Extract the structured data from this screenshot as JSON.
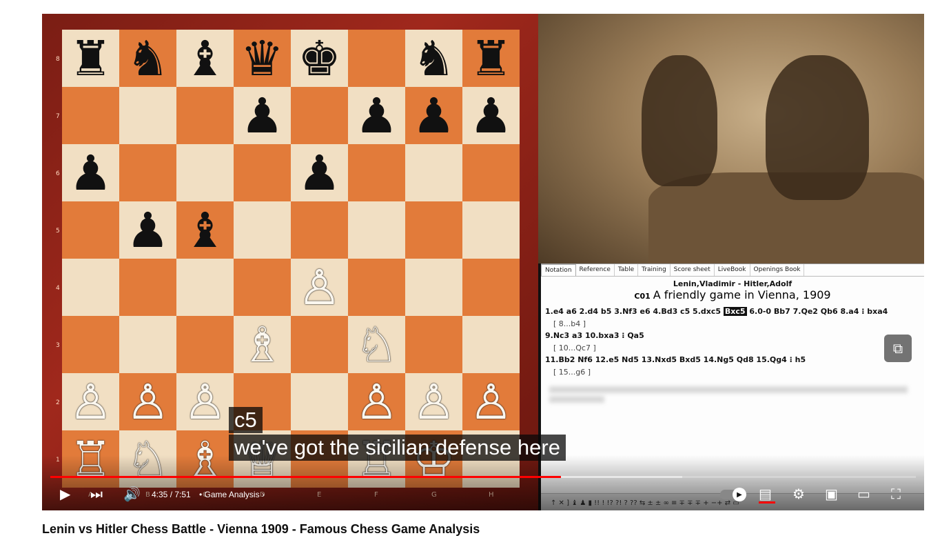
{
  "board": {
    "ranks": [
      "8",
      "7",
      "6",
      "5",
      "4",
      "3",
      "2",
      "1"
    ],
    "files": [
      "A",
      "B",
      "C",
      "D",
      "E",
      "F",
      "G",
      "H"
    ],
    "rows": [
      [
        {
          "p": "♜",
          "c": "b"
        },
        {
          "p": "♞",
          "c": "b"
        },
        {
          "p": "♝",
          "c": "b"
        },
        {
          "p": "♛",
          "c": "b"
        },
        {
          "p": "♚",
          "c": "b"
        },
        {
          "p": "",
          "c": ""
        },
        {
          "p": "♞",
          "c": "b"
        },
        {
          "p": "♜",
          "c": "b"
        }
      ],
      [
        {
          "p": "",
          "c": ""
        },
        {
          "p": "",
          "c": ""
        },
        {
          "p": "",
          "c": ""
        },
        {
          "p": "♟",
          "c": "b"
        },
        {
          "p": "",
          "c": ""
        },
        {
          "p": "♟",
          "c": "b"
        },
        {
          "p": "♟",
          "c": "b"
        },
        {
          "p": "♟",
          "c": "b"
        }
      ],
      [
        {
          "p": "♟",
          "c": "b"
        },
        {
          "p": "",
          "c": ""
        },
        {
          "p": "",
          "c": ""
        },
        {
          "p": "",
          "c": ""
        },
        {
          "p": "♟",
          "c": "b"
        },
        {
          "p": "",
          "c": ""
        },
        {
          "p": "",
          "c": ""
        },
        {
          "p": "",
          "c": ""
        }
      ],
      [
        {
          "p": "",
          "c": ""
        },
        {
          "p": "♟",
          "c": "b"
        },
        {
          "p": "♝",
          "c": "b"
        },
        {
          "p": "",
          "c": ""
        },
        {
          "p": "",
          "c": ""
        },
        {
          "p": "",
          "c": ""
        },
        {
          "p": "",
          "c": ""
        },
        {
          "p": "",
          "c": ""
        }
      ],
      [
        {
          "p": "",
          "c": ""
        },
        {
          "p": "",
          "c": ""
        },
        {
          "p": "",
          "c": ""
        },
        {
          "p": "",
          "c": ""
        },
        {
          "p": "♙",
          "c": "w"
        },
        {
          "p": "",
          "c": ""
        },
        {
          "p": "",
          "c": ""
        },
        {
          "p": "",
          "c": ""
        }
      ],
      [
        {
          "p": "",
          "c": ""
        },
        {
          "p": "",
          "c": ""
        },
        {
          "p": "",
          "c": ""
        },
        {
          "p": "♗",
          "c": "w"
        },
        {
          "p": "",
          "c": ""
        },
        {
          "p": "♘",
          "c": "w"
        },
        {
          "p": "",
          "c": ""
        },
        {
          "p": "",
          "c": ""
        }
      ],
      [
        {
          "p": "♙",
          "c": "w"
        },
        {
          "p": "♙",
          "c": "w"
        },
        {
          "p": "♙",
          "c": "w"
        },
        {
          "p": "",
          "c": ""
        },
        {
          "p": "",
          "c": ""
        },
        {
          "p": "♙",
          "c": "w"
        },
        {
          "p": "♙",
          "c": "w"
        },
        {
          "p": "♙",
          "c": "w"
        }
      ],
      [
        {
          "p": "♖",
          "c": "w"
        },
        {
          "p": "♘",
          "c": "w"
        },
        {
          "p": "♗",
          "c": "w"
        },
        {
          "p": "♕",
          "c": "w"
        },
        {
          "p": "",
          "c": ""
        },
        {
          "p": "♖",
          "c": "w"
        },
        {
          "p": "♔",
          "c": "w"
        },
        {
          "p": "",
          "c": ""
        }
      ]
    ]
  },
  "notation": {
    "tabs": [
      "Notation",
      "Reference",
      "Table",
      "Training",
      "Score sheet",
      "LiveBook",
      "Openings Book"
    ],
    "players": "Lenin,Vladimir - Hitler,Adolf",
    "eco": "C01",
    "event": "A friendly game in Vienna, 1909",
    "line1_a": "1.e4  a6  2.d4  b5  3.Nf3  e6  4.Bd3  c5  5.dxc5 ",
    "line1_hl": "Bxc5",
    "line1_b": " 6.0-0  Bb7  7.Qe2  Qb6  8.a4  ⁝  bxa4",
    "var1": "[ 8...b4 ]",
    "line2": "9.Nc3  a3  10.bxa3  ⁝  Qa5",
    "var2": "[ 10...Qc7 ]",
    "line3": "11.Bb2  Nf6  12.e5  Nd5  13.Nxd5  Bxd5  14.Ng5  Qd8  15.Qg4  ⁝  h5",
    "var3": "[ 15...g6 ]",
    "toolbar": "↑  ✕  ]  ♝  ♟  ▮  !!   !   !?  ?!   ?   ??   ⇆   ±   ±   ∞   ≡   ∓   ∓   ∓   +  −+  ⇄  ▭"
  },
  "captions": {
    "line1": "c5",
    "line2": "we've got the sicilian defense here"
  },
  "controls": {
    "time": "4:35 / 7:51",
    "chapter": "• Game Analysis  ›",
    "played_fraction": 0.59,
    "buffered_fraction": 0.73,
    "icons": [
      "play-icon",
      "next-icon",
      "volume-icon",
      "autoplay-toggle",
      "subtitles-icon",
      "settings-icon",
      "miniplayer-icon",
      "theater-icon",
      "fullscreen-icon"
    ]
  },
  "video_title": "Lenin vs Hitler Chess Battle - Vienna 1909 - Famous Chess Game Analysis"
}
